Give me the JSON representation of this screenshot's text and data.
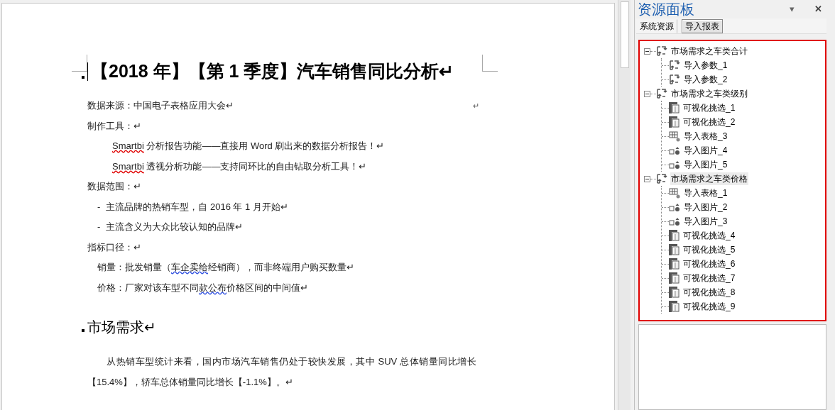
{
  "document": {
    "title": "【2018 年】【第 1 季度】汽车销售同比分析↵",
    "lines": [
      {
        "kind": "para",
        "parts": [
          {
            "text": "数据来源：中国电子表格应用大会↵"
          }
        ],
        "end_mark": "↵"
      },
      {
        "kind": "para",
        "parts": [
          {
            "text": "制作工具：↵"
          }
        ]
      },
      {
        "kind": "indent",
        "parts": [
          {
            "text": "Smartbi",
            "kind": "spelling"
          },
          {
            "text": " 分析报告功能——直接用 Word 刷出来的数据分析报告！↵"
          }
        ]
      },
      {
        "kind": "indent",
        "parts": [
          {
            "text": "Smartbi",
            "kind": "spelling"
          },
          {
            "text": " 透视分析功能——支持同环比的自由钻取分析工具！↵"
          }
        ]
      },
      {
        "kind": "para",
        "parts": [
          {
            "text": "数据范围：↵"
          }
        ]
      },
      {
        "kind": "bullet",
        "bullet": "-",
        "parts": [
          {
            "text": "主流品牌的热销车型，自 2016 年 1 月开始↵"
          }
        ]
      },
      {
        "kind": "bullet",
        "bullet": "-",
        "parts": [
          {
            "text": "主流含义为大众比较认知的品牌↵"
          }
        ]
      },
      {
        "kind": "para",
        "parts": [
          {
            "text": "指标口径：↵"
          }
        ]
      },
      {
        "kind": "sub",
        "parts": [
          {
            "text": "销量：批发销量（"
          },
          {
            "text": "车企卖给",
            "kind": "grammar"
          },
          {
            "text": "经销商），而非终端用户购买数量↵"
          }
        ]
      },
      {
        "kind": "sub",
        "parts": [
          {
            "text": "价格：厂家对该车型不同"
          },
          {
            "text": "款公布",
            "kind": "grammar"
          },
          {
            "text": "价格区间的中间值↵"
          }
        ]
      },
      {
        "kind": "heading",
        "parts": [
          {
            "text": "市场需求↵"
          }
        ]
      },
      {
        "kind": "body",
        "parts": [
          {
            "text": "从热销车型统计来看，国内市场汽车销售仍处于较快发展，其中 SUV 总体销量同比增长【15.4%】，轿车总体销量同比增长【-1.1%】。↵"
          }
        ]
      }
    ]
  },
  "panel": {
    "title": "资源面板",
    "menu": "▾",
    "close": "✕",
    "tabs": [
      {
        "label": "系统资源",
        "selected": false
      },
      {
        "label": "导入报表",
        "selected": true
      }
    ],
    "tree": [
      {
        "label": "市场需求之车类合计",
        "kind": "param",
        "expanded": true,
        "selected": false,
        "children": [
          {
            "label": "导入参数_1",
            "kind": "param",
            "selected": false
          },
          {
            "label": "导入参数_2",
            "kind": "param",
            "selected": false
          }
        ]
      },
      {
        "label": "市场需求之车类级别",
        "kind": "param",
        "expanded": true,
        "selected": false,
        "children": [
          {
            "label": "可视化挑选_1",
            "kind": "visual",
            "selected": false
          },
          {
            "label": "可视化挑选_2",
            "kind": "visual",
            "selected": false
          },
          {
            "label": "导入表格_3",
            "kind": "table",
            "selected": false
          },
          {
            "label": "导入图片_4",
            "kind": "image",
            "selected": false
          },
          {
            "label": "导入图片_5",
            "kind": "image",
            "selected": false
          }
        ]
      },
      {
        "label": "市场需求之车类价格",
        "kind": "param",
        "expanded": true,
        "selected": true,
        "children": [
          {
            "label": "导入表格_1",
            "kind": "table",
            "selected": false
          },
          {
            "label": "导入图片_2",
            "kind": "image",
            "selected": false
          },
          {
            "label": "导入图片_3",
            "kind": "image",
            "selected": false
          },
          {
            "label": "可视化挑选_4",
            "kind": "visual",
            "selected": false
          },
          {
            "label": "可视化挑选_5",
            "kind": "visual",
            "selected": false
          },
          {
            "label": "可视化挑选_6",
            "kind": "visual",
            "selected": false
          },
          {
            "label": "可视化挑选_7",
            "kind": "visual",
            "selected": false
          },
          {
            "label": "可视化挑选_8",
            "kind": "visual",
            "selected": false
          },
          {
            "label": "可视化挑选_9",
            "kind": "visual",
            "selected": false
          }
        ]
      }
    ]
  }
}
